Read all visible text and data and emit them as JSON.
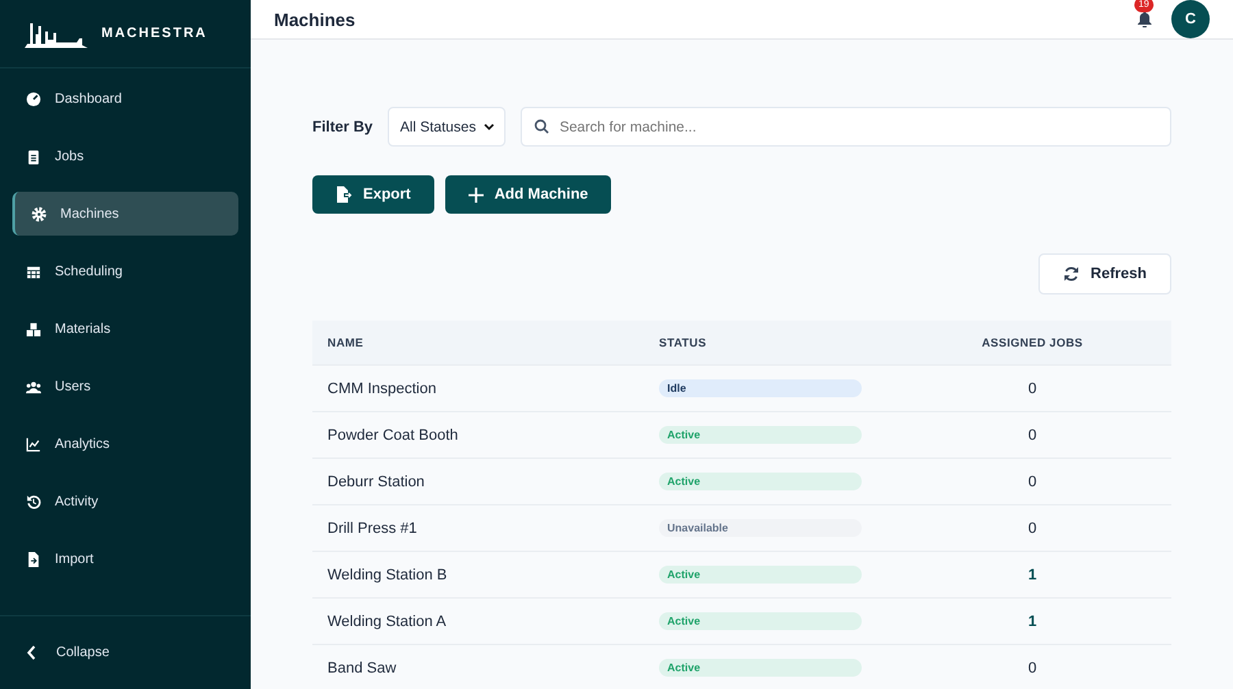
{
  "brand": "MACHESTRA",
  "sidebar": {
    "items": [
      {
        "label": "Dashboard",
        "selected": false
      },
      {
        "label": "Jobs",
        "selected": false
      },
      {
        "label": "Machines",
        "selected": true
      },
      {
        "label": "Scheduling",
        "selected": false
      },
      {
        "label": "Materials",
        "selected": false
      },
      {
        "label": "Users",
        "selected": false
      },
      {
        "label": "Analytics",
        "selected": false
      },
      {
        "label": "Activity",
        "selected": false
      },
      {
        "label": "Import",
        "selected": false
      }
    ],
    "collapse": "Collapse"
  },
  "header": {
    "title": "Machines",
    "notifications": "19",
    "avatar": "C"
  },
  "filter": {
    "label": "Filter By",
    "status_select": "All Statuses",
    "search_placeholder": "Search for machine..."
  },
  "actions": [
    "Export",
    "Add Machine"
  ],
  "refresh": "Refresh",
  "table": {
    "columns": [
      "NAME",
      "STATUS",
      "ASSIGNED JOBS"
    ],
    "rows": [
      {
        "name": "CMM Inspection",
        "status": "Idle",
        "kind": "idle",
        "jobs": "0",
        "highlighted": false
      },
      {
        "name": "Powder Coat Booth",
        "status": "Active",
        "kind": "active",
        "jobs": "0",
        "highlighted": false
      },
      {
        "name": "Deburr Station",
        "status": "Active",
        "kind": "active",
        "jobs": "0",
        "highlighted": false
      },
      {
        "name": "Drill Press #1",
        "status": "Unavailable",
        "kind": "unavailable",
        "jobs": "0",
        "highlighted": false
      },
      {
        "name": "Welding Station B",
        "status": "Active",
        "kind": "active",
        "jobs": "1",
        "highlighted": true
      },
      {
        "name": "Welding Station A",
        "status": "Active",
        "kind": "active",
        "jobs": "1",
        "highlighted": true
      },
      {
        "name": "Band Saw",
        "status": "Active",
        "kind": "active",
        "jobs": "0",
        "highlighted": false
      }
    ]
  }
}
